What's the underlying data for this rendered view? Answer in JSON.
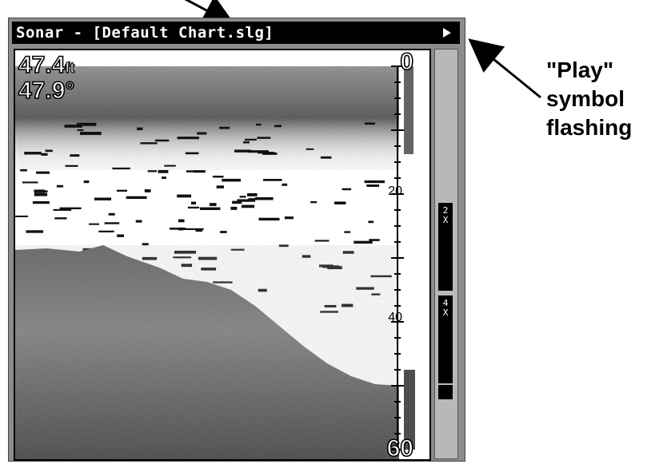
{
  "window": {
    "title": "Sonar - [Default Chart.slg]",
    "play_icon": "play-icon"
  },
  "readouts": {
    "depth_value": "47.4",
    "depth_unit": "ft",
    "temperature": "47.9°"
  },
  "depth_scale": {
    "top": "0",
    "mid_1": "20",
    "mid_2": "40",
    "bottom": "60"
  },
  "zoom_bar": {
    "label_1": "2X",
    "label_2": "4X"
  },
  "annotation": {
    "line_1": "\"Play\"",
    "line_2": "symbol",
    "line_3": "flashing"
  },
  "colors": {
    "titlebar": "#000000",
    "frame": "#8c8c8c",
    "zoom_bar": "#b8b8b8"
  }
}
